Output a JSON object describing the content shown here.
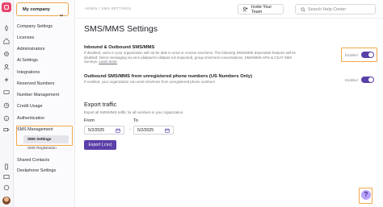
{
  "company": {
    "name": "My company"
  },
  "menu": {
    "items": [
      "Company Settings",
      "Licenses",
      "Administrators",
      "Ai Settings",
      "Integrations",
      "Reserved Numbers",
      "Number Management",
      "Credit Usage",
      "Authentication"
    ],
    "sms_management": "SMS Management",
    "sms_settings": "SMS Settings",
    "sms_registration": "SMS Registration",
    "shared_contacts": "Shared Contacts",
    "deskphone_settings": "Deskphone Settings"
  },
  "topbar": {
    "breadcrumb": "ADMIN / SMS SETTINGS",
    "invite_label": "Invite Your Team",
    "search_placeholder": "Search Help Center"
  },
  "page": {
    "title": "SMS/MMS Settings",
    "inbound": {
      "title": "Inbound & Outbound SMS/MMS",
      "desc_line1": "If disabled, users in your organization will not be able to send or receive sms/mms. The following SMS/MMS dependant features will be",
      "desc_line2": "disabled: Direct messaging via sms (dialpad-to-dialpad not impacted), group sms/mms conversations, SMS/MMS APIs & CSAT SMS",
      "desc_line3_prefix": "Surveys.",
      "desc_link": "Learn more",
      "toggle_label": "Enabled",
      "enabled": true
    },
    "outbound_unregistered": {
      "title": "Outbound SMS/MMS from unregistered phone numbers (US Numbers Only)",
      "desc": "If enabled, your organization can send sms/mms from unregistered phone numbers.",
      "toggle_label": "Enabled",
      "enabled": true
    },
    "export": {
      "title": "Export traffic",
      "desc": "Export all SMS/MMS traffic for all numbers in your organization.",
      "from_label": "From",
      "to_label": "To",
      "from_value": "5/2/2025",
      "to_value": "5/2/2025",
      "separator": "-",
      "button_label": "Export (.csv)"
    }
  },
  "help": {
    "label": "?"
  },
  "colors": {
    "accent": "#5b3fa8",
    "highlight": "#f0a84a",
    "brand": "#e8436c"
  },
  "icons": [
    "rocket-icon",
    "home-icon",
    "users-icon",
    "settings-icon",
    "bolt-icon",
    "chat-icon",
    "history-icon",
    "info-icon",
    "video-icon",
    "phone-icon",
    "monitor-icon",
    "help-icon"
  ]
}
